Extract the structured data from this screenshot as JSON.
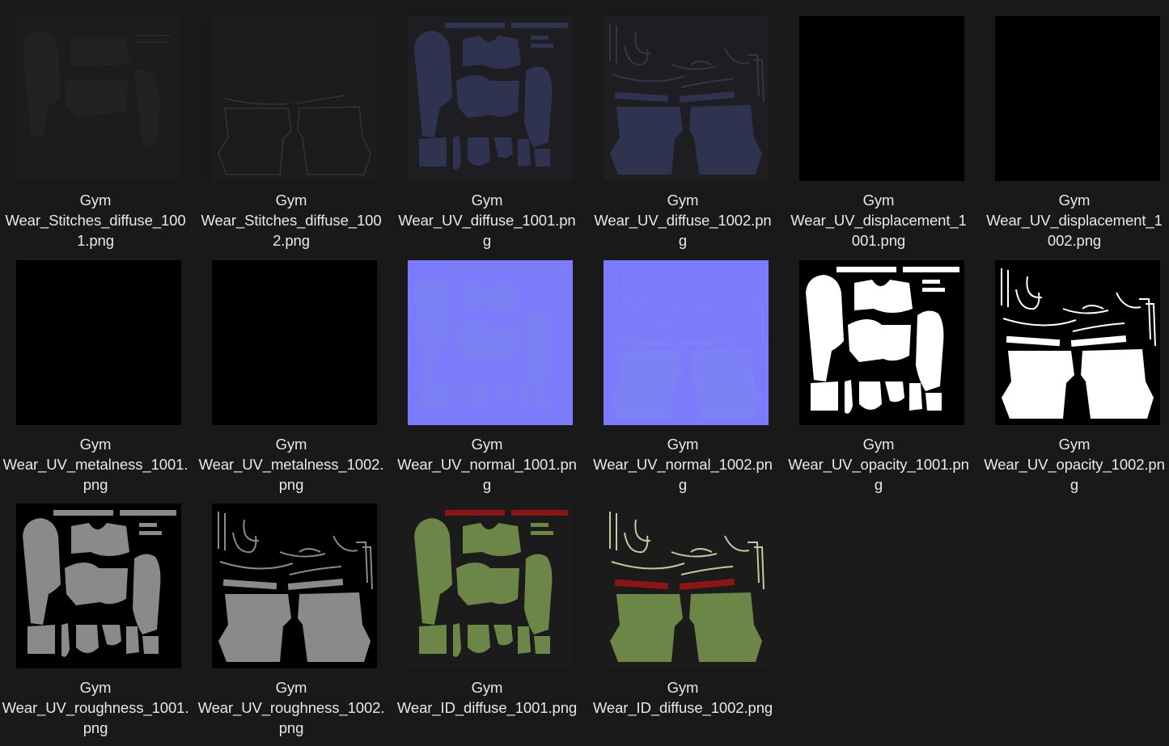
{
  "files": [
    {
      "lines": [
        "Gym",
        "Wear_Stitches_diffuse_100",
        "1.png"
      ],
      "icon": "texture-thumbnail-icon",
      "kind": "stitch-mask",
      "bg": "#1c1c1c",
      "fill": "#222222",
      "stroke": "#2a2a2a"
    },
    {
      "lines": [
        "Gym",
        "Wear_Stitches_diffuse_100",
        "2.png"
      ],
      "icon": "texture-thumbnail-icon",
      "kind": "stitch-pants",
      "bg": "#1c1c1c",
      "fill": "#1f1f1f",
      "stroke": "#333333"
    },
    {
      "lines": [
        "Gym",
        "Wear_UV_diffuse_1001.pn",
        "g"
      ],
      "icon": "texture-thumbnail-icon",
      "kind": "shirt",
      "bg": "#1e1e22",
      "fill": "#2f3350",
      "stroke": "#30344f"
    },
    {
      "lines": [
        "Gym",
        "Wear_UV_diffuse_1002.pn",
        "g"
      ],
      "icon": "texture-thumbnail-icon",
      "kind": "pants",
      "bg": "#1e1e22",
      "fill": "#2f3350",
      "stroke": "#333548"
    },
    {
      "lines": [
        "Gym",
        "Wear_UV_displacement_1",
        "001.png"
      ],
      "icon": "texture-thumbnail-icon",
      "kind": "solid",
      "bg": "#000000",
      "fill": "#000000",
      "stroke": "#000000"
    },
    {
      "lines": [
        "Gym",
        "Wear_UV_displacement_1",
        "002.png"
      ],
      "icon": "texture-thumbnail-icon",
      "kind": "solid",
      "bg": "#000000",
      "fill": "#000000",
      "stroke": "#000000"
    },
    {
      "lines": [
        "Gym",
        "Wear_UV_metalness_1001.",
        "png"
      ],
      "icon": "texture-thumbnail-icon",
      "kind": "solid",
      "bg": "#000000",
      "fill": "#000000",
      "stroke": "#000000"
    },
    {
      "lines": [
        "Gym",
        "Wear_UV_metalness_1002.",
        "png"
      ],
      "icon": "texture-thumbnail-icon",
      "kind": "solid",
      "bg": "#000000",
      "fill": "#000000",
      "stroke": "#000000"
    },
    {
      "lines": [
        "Gym",
        "Wear_UV_normal_1001.pn",
        "g"
      ],
      "icon": "texture-thumbnail-icon",
      "kind": "shirt",
      "bg": "#7b7bfb",
      "fill": "#7a80f4",
      "stroke": "#7f7ff6"
    },
    {
      "lines": [
        "Gym",
        "Wear_UV_normal_1002.pn",
        "g"
      ],
      "icon": "texture-thumbnail-icon",
      "kind": "pants",
      "bg": "#7b7bfb",
      "fill": "#7c82f5",
      "stroke": "#8080f6"
    },
    {
      "lines": [
        "Gym",
        "Wear_UV_opacity_1001.pn",
        "g"
      ],
      "icon": "texture-thumbnail-icon",
      "kind": "shirt",
      "bg": "#000000",
      "fill": "#ffffff",
      "stroke": "#ffffff"
    },
    {
      "lines": [
        "Gym",
        "Wear_UV_opacity_1002.pn",
        "g"
      ],
      "icon": "texture-thumbnail-icon",
      "kind": "pants",
      "bg": "#000000",
      "fill": "#ffffff",
      "stroke": "#ffffff"
    },
    {
      "lines": [
        "Gym",
        "Wear_UV_roughness_1001.",
        "png"
      ],
      "icon": "texture-thumbnail-icon",
      "kind": "shirt",
      "bg": "#000000",
      "fill": "#8a8a8a",
      "stroke": "#8a8a8a"
    },
    {
      "lines": [
        "Gym",
        "Wear_UV_roughness_1002.",
        "png"
      ],
      "icon": "texture-thumbnail-icon",
      "kind": "pants",
      "bg": "#000000",
      "fill": "#8a8a8a",
      "stroke": "#8a8a8a"
    },
    {
      "lines": [
        "Gym",
        "Wear_ID_diffuse_1001.png"
      ],
      "icon": "texture-thumbnail-icon",
      "kind": "shirt-id",
      "bg": "#1b1b1b",
      "fill": "#6b8646",
      "stroke": "#8b1616"
    },
    {
      "lines": [
        "Gym",
        "Wear_ID_diffuse_1002.png"
      ],
      "icon": "texture-thumbnail-icon",
      "kind": "pants-id",
      "bg": "#1b1b1b",
      "fill": "#6b8646",
      "stroke": "#8b1616"
    }
  ]
}
